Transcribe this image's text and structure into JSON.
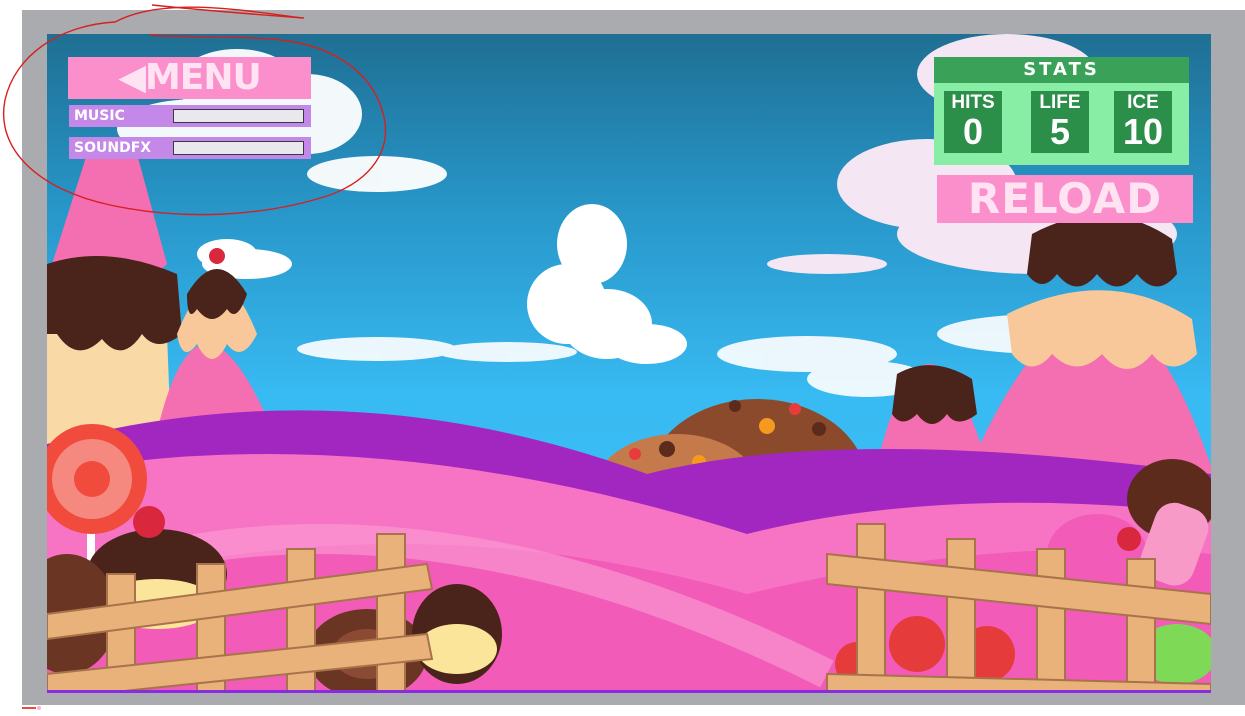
{
  "menu": {
    "label": "◀MENU"
  },
  "audio": {
    "music": {
      "label": "MUSIC",
      "level": 0
    },
    "soundfx": {
      "label": "SOUNDFX",
      "level": 0
    }
  },
  "stats": {
    "title": "STATS",
    "items": [
      {
        "label": "HITS",
        "value": "0"
      },
      {
        "label": "LIFE",
        "value": "5"
      },
      {
        "label": "ICE",
        "value": "10"
      }
    ]
  },
  "reload": {
    "label": "RELOAD"
  },
  "colors": {
    "button_pink": "#fa8fcb",
    "slider_purple": "#c488e8",
    "stats_green": "#3aa158",
    "stats_panel": "#88eea5",
    "sky": "#37b3ef",
    "annotation_red": "#d62020"
  }
}
